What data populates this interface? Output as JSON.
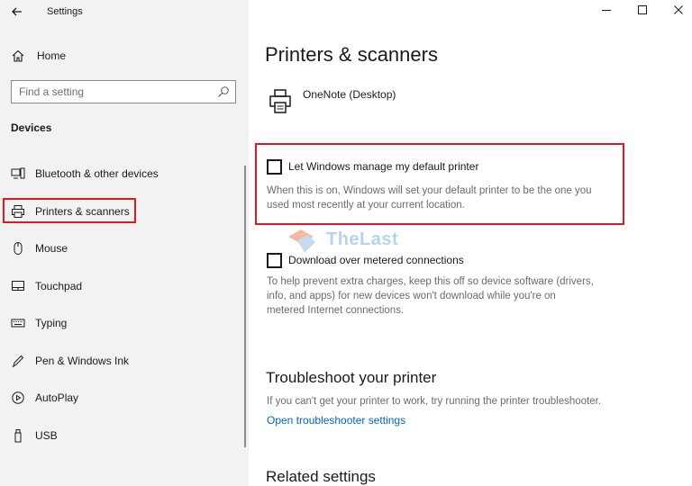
{
  "window": {
    "title": "Settings"
  },
  "sidebar": {
    "home_label": "Home",
    "search_placeholder": "Find a setting",
    "section_title": "Devices",
    "items": [
      {
        "label": "Bluetooth & other devices",
        "icon": "bluetooth-devices-icon"
      },
      {
        "label": "Printers & scanners",
        "icon": "printer-icon"
      },
      {
        "label": "Mouse",
        "icon": "mouse-icon"
      },
      {
        "label": "Touchpad",
        "icon": "touchpad-icon"
      },
      {
        "label": "Typing",
        "icon": "keyboard-icon"
      },
      {
        "label": "Pen & Windows Ink",
        "icon": "pen-icon"
      },
      {
        "label": "AutoPlay",
        "icon": "autoplay-icon"
      },
      {
        "label": "USB",
        "icon": "usb-icon"
      }
    ]
  },
  "main": {
    "page_title": "Printers & scanners",
    "printer_name": "OneNote (Desktop)",
    "default_printer": {
      "label": "Let Windows manage my default printer",
      "checked": false,
      "description_line1": "When this is on, Windows will set your default printer to be the one you",
      "description_line2": "used most recently at your current location."
    },
    "metered": {
      "label": "Download over metered connections",
      "checked": false,
      "description_line1": "To help prevent extra charges, keep this off so device software (drivers,",
      "description_line2": "info, and apps) for new devices won't download while you're on",
      "description_line3": "metered Internet connections."
    },
    "troubleshoot": {
      "heading": "Troubleshoot your printer",
      "text": "If you can't get your printer to work, try running the printer troubleshooter.",
      "link": "Open troubleshooter settings"
    },
    "related_heading": "Related settings"
  },
  "watermark": {
    "text": "TheLast"
  },
  "colors": {
    "sidebar_bg": "#f2f2f2",
    "highlight": "#e0191f",
    "link": "#0067b8",
    "watermark": "#b6d4f0"
  }
}
